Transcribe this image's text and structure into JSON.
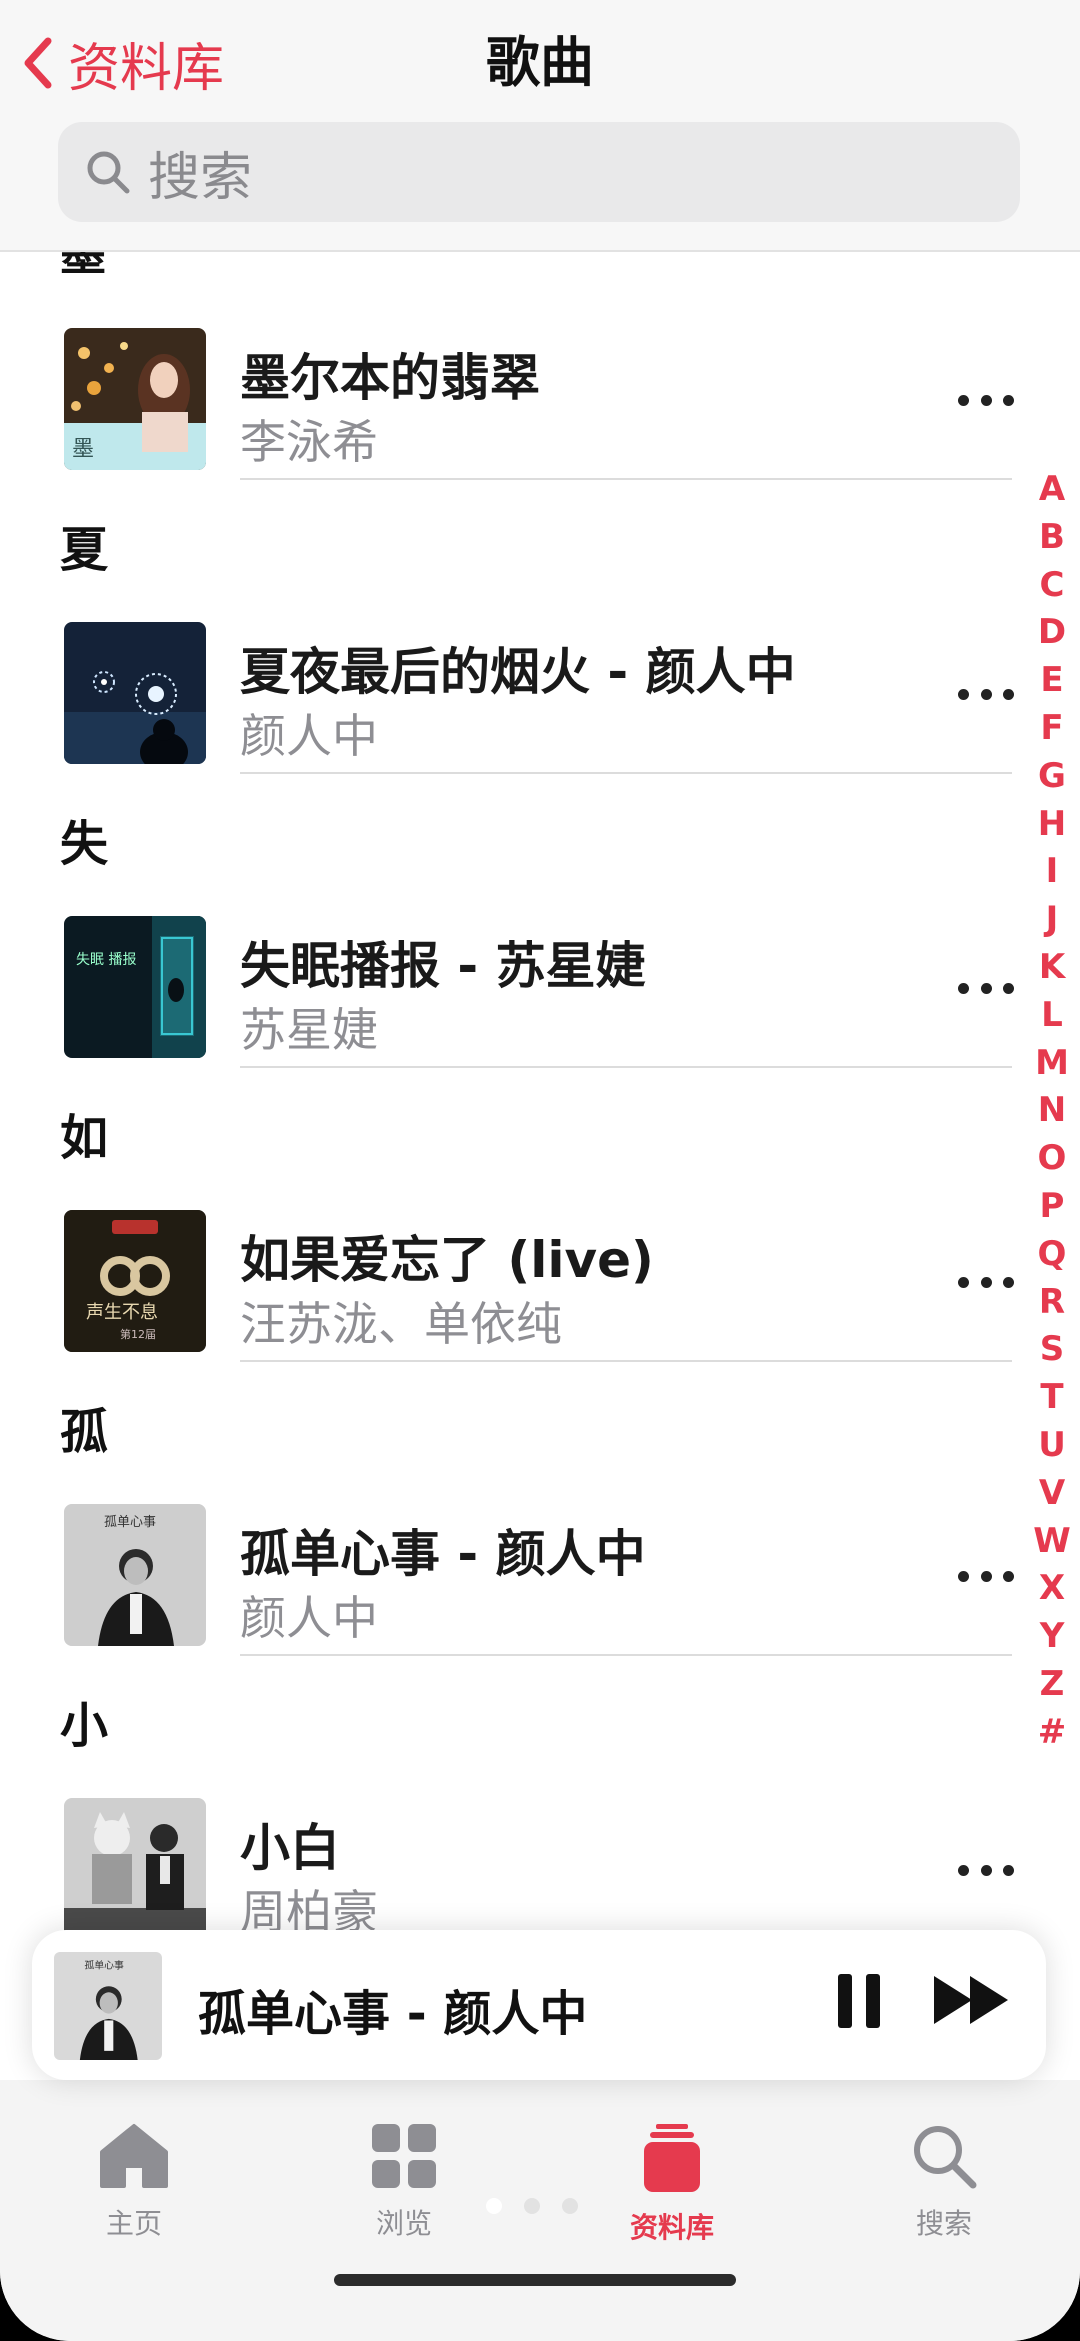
{
  "header": {
    "back_label": "资料库",
    "title": "歌曲",
    "search_placeholder": "搜索"
  },
  "list": {
    "cut_section": "墨",
    "sections": [
      {
        "header": null,
        "song": {
          "title": "墨尔本的翡翠",
          "artist": "李泳希",
          "cover": "melbourne-cover"
        }
      },
      {
        "header": "夏",
        "song": {
          "title": "夏夜最后的烟火 - 颜人中",
          "artist": "颜人中",
          "cover": "fireworks-cover"
        }
      },
      {
        "header": "失",
        "song": {
          "title": "失眠播报 - 苏星婕",
          "artist": "苏星婕",
          "cover": "insomnia-cover"
        }
      },
      {
        "header": "如",
        "song": {
          "title": "如果爱忘了 (live)",
          "artist": "汪苏泷、单依纯",
          "cover": "live-show-cover"
        }
      },
      {
        "header": "孤",
        "song": {
          "title": "孤单心事 - 颜人中",
          "artist": "颜人中",
          "cover": "lonely-cover"
        }
      },
      {
        "header": "小",
        "song": {
          "title": "小白",
          "artist": "周柏豪",
          "cover": "xiaobai-cover"
        }
      }
    ]
  },
  "alphabet_index": [
    "A",
    "B",
    "C",
    "D",
    "E",
    "F",
    "G",
    "H",
    "I",
    "J",
    "K",
    "L",
    "M",
    "N",
    "O",
    "P",
    "Q",
    "R",
    "S",
    "T",
    "U",
    "V",
    "W",
    "X",
    "Y",
    "Z",
    "#"
  ],
  "now_playing": {
    "title": "孤单心事 - 颜人中",
    "playing": true
  },
  "tabs": [
    {
      "label": "主页",
      "icon": "home-icon",
      "active": false
    },
    {
      "label": "浏览",
      "icon": "grid-icon",
      "active": false
    },
    {
      "label": "资料库",
      "icon": "library-icon",
      "active": true
    },
    {
      "label": "搜索",
      "icon": "search-icon",
      "active": false
    }
  ],
  "colors": {
    "accent": "#e53a4e",
    "secondary_text": "#8e8e93"
  }
}
